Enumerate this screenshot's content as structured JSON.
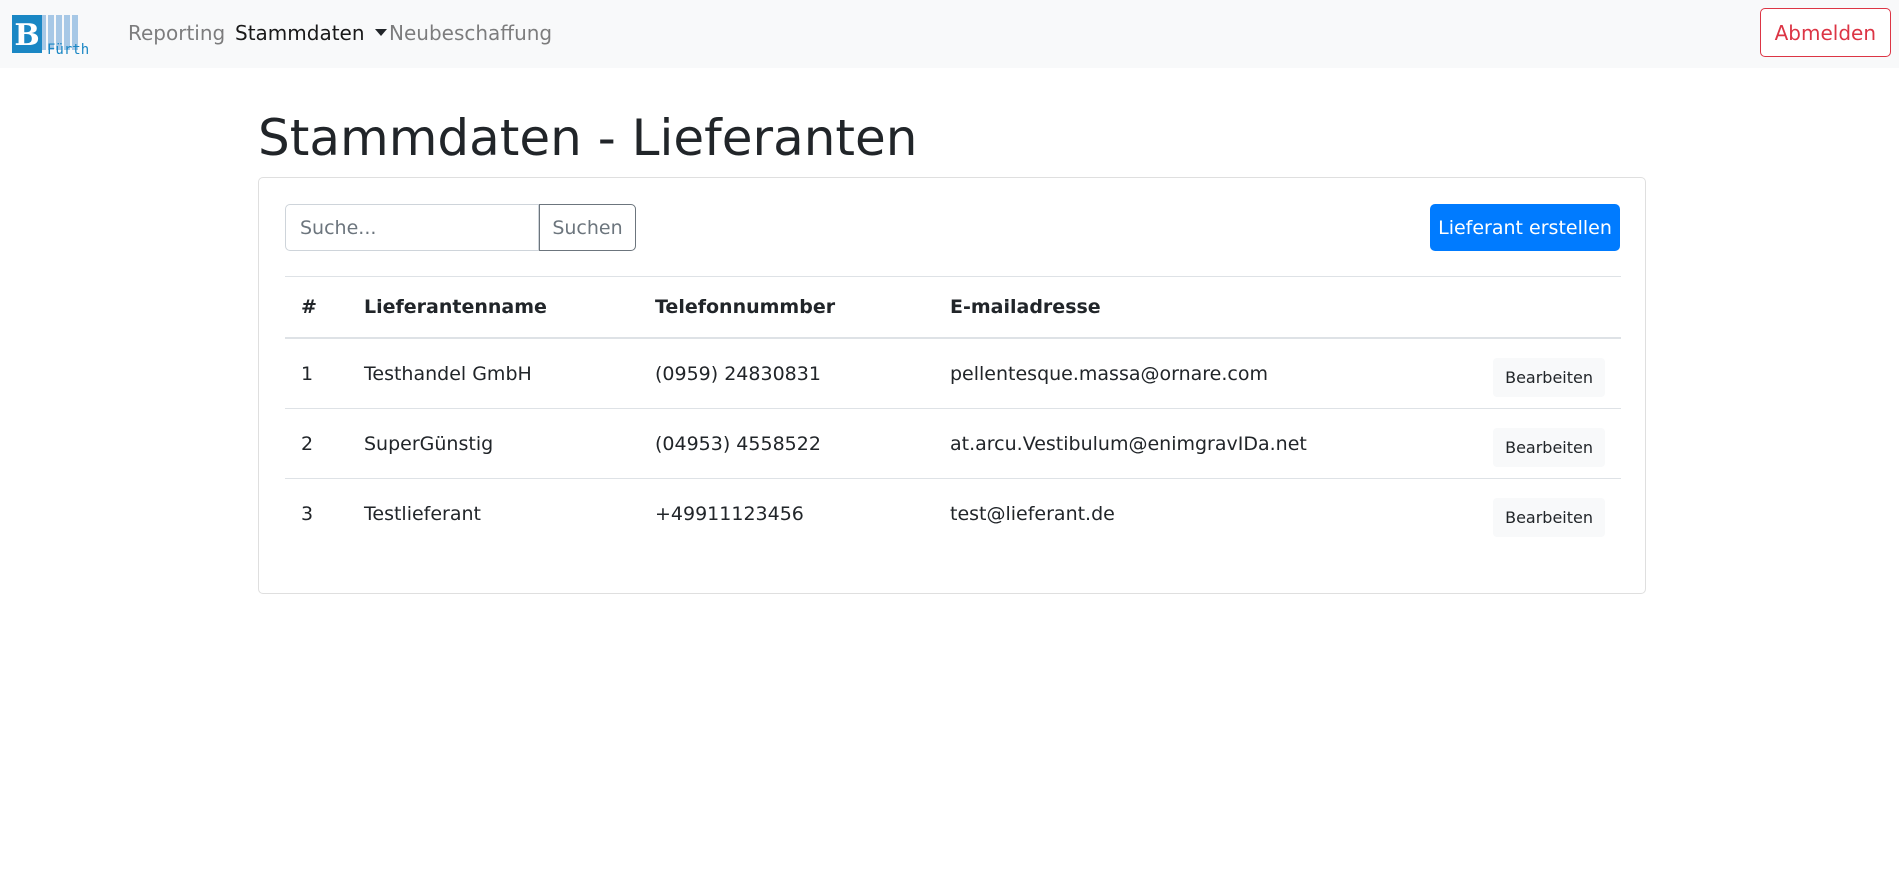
{
  "navbar": {
    "logo": {
      "letter": "B",
      "text": "Fürth",
      "colors": {
        "primary": "#1a87c4",
        "stripes": "#a7c8e6"
      }
    },
    "links": [
      {
        "label": "Reporting",
        "active": false
      },
      {
        "label": "Stammdaten",
        "active": true,
        "dropdown": true
      },
      {
        "label": "Neubeschaffung",
        "active": false
      }
    ],
    "logout_label": "Abmelden"
  },
  "page": {
    "title": "Stammdaten - Lieferanten"
  },
  "toolbar": {
    "search_placeholder": "Suche...",
    "search_label": "Suchen",
    "create_label": "Lieferant erstellen"
  },
  "table": {
    "headers": [
      "#",
      "Lieferantenname",
      "Telefonnummber",
      "E-mailadresse"
    ],
    "rows": [
      {
        "num": "1",
        "name": "Testhandel GmbH",
        "phone": "(0959) 24830831",
        "email": "pellentesque.massa@ornare.com",
        "action": "Bearbeiten"
      },
      {
        "num": "2",
        "name": "SuperGünstig",
        "phone": "(04953) 4558522",
        "email": "at.arcu.Vestibulum@enimgravIDa.net",
        "action": "Bearbeiten"
      },
      {
        "num": "3",
        "name": "Testlieferant",
        "phone": "+49911123456",
        "email": "test@lieferant.de",
        "action": "Bearbeiten"
      }
    ]
  },
  "colors": {
    "primary": "#007bff",
    "danger": "#dc3545",
    "secondary": "#6c757d",
    "navbar_bg": "#f8f9fa"
  }
}
